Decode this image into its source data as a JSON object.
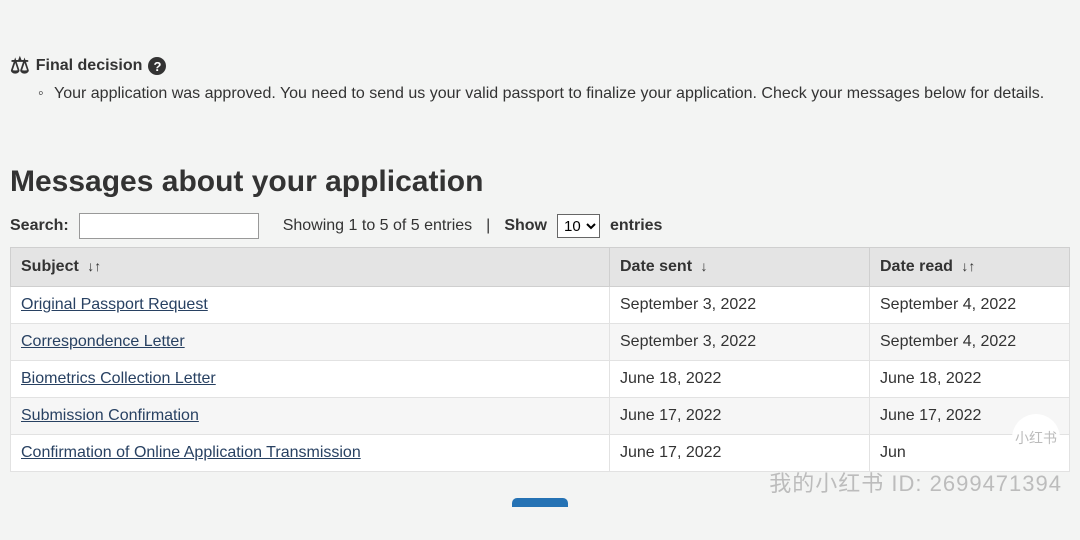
{
  "final_decision": {
    "heading": "Final decision",
    "message": "Your application was approved. You need to send us your valid passport to finalize your application. Check your messages below for details."
  },
  "messages_section": {
    "heading": "Messages about your application",
    "search_label": "Search:",
    "search_value": "",
    "showing_text": "Showing 1 to 5 of 5 entries",
    "show_label": "Show",
    "entries_label": "entries",
    "page_size_selected": "10",
    "columns": {
      "subject": "Subject",
      "date_sent": "Date sent",
      "date_read": "Date read"
    },
    "rows": [
      {
        "subject": "Original Passport Request",
        "date_sent": "September 3, 2022",
        "date_read": "September 4, 2022"
      },
      {
        "subject": "Correspondence Letter",
        "date_sent": "September 3, 2022",
        "date_read": "September 4, 2022"
      },
      {
        "subject": "Biometrics Collection Letter",
        "date_sent": "June 18, 2022",
        "date_read": "June 18, 2022"
      },
      {
        "subject": "Submission Confirmation",
        "date_sent": "June 17, 2022",
        "date_read": "June 17, 2022"
      },
      {
        "subject": "Confirmation of Online Application Transmission",
        "date_sent": "June 17, 2022",
        "date_read": "Jun"
      }
    ]
  },
  "watermark": {
    "badge_text": "小红书",
    "line_text": "我的小红书 ID: 2699471394"
  }
}
